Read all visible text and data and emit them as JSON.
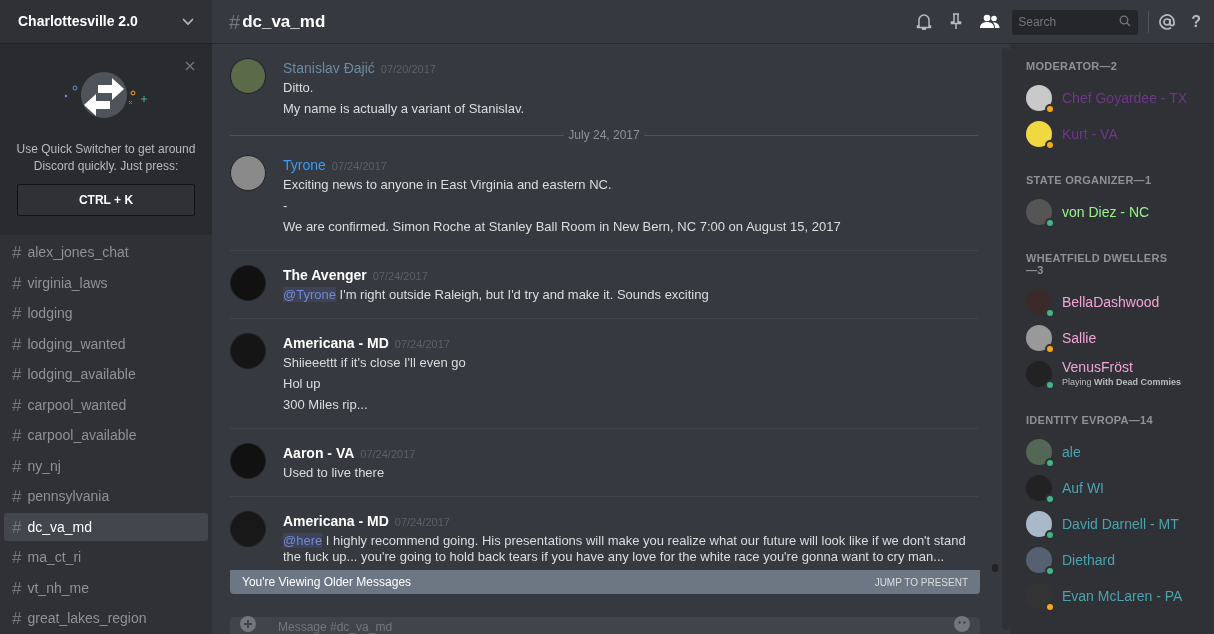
{
  "server": {
    "name": "Charlottesville 2.0"
  },
  "quick_switcher": {
    "text": "Use Quick Switcher to get around Discord quickly. Just press:",
    "shortcut": "CTRL + K"
  },
  "channels": [
    {
      "name": "alex_jones_chat",
      "selected": false
    },
    {
      "name": "virginia_laws",
      "selected": false
    },
    {
      "name": "lodging",
      "selected": false
    },
    {
      "name": "lodging_wanted",
      "selected": false
    },
    {
      "name": "lodging_available",
      "selected": false
    },
    {
      "name": "carpool_wanted",
      "selected": false
    },
    {
      "name": "carpool_available",
      "selected": false
    },
    {
      "name": "ny_nj",
      "selected": false
    },
    {
      "name": "pennsylvania",
      "selected": false
    },
    {
      "name": "dc_va_md",
      "selected": true
    },
    {
      "name": "ma_ct_ri",
      "selected": false
    },
    {
      "name": "vt_nh_me",
      "selected": false
    },
    {
      "name": "great_lakes_region",
      "selected": false
    }
  ],
  "header": {
    "hash": "#",
    "channel": "dc_va_md",
    "search_placeholder": "Search",
    "help": "?"
  },
  "messages": [
    {
      "kind": "message",
      "author": "Stanislav Đajić",
      "color": "#6d8aa3",
      "time": "07/20/2017",
      "lines": [
        {
          "text": "Ditto."
        },
        {
          "text": "My name is actually a variant of Stanislav."
        }
      ]
    },
    {
      "kind": "divider",
      "text": "July 24, 2017"
    },
    {
      "kind": "message",
      "author": "Tyrone",
      "color": "#3d9cf0",
      "time": "07/24/2017",
      "lines": [
        {
          "text": "Exciting news to anyone in East Virginia and eastern NC."
        },
        {
          "text": "-"
        },
        {
          "text": "We are confirmed. Simon Roche at Stanley Ball Room in New Bern, NC 7:00 on August 15, 2017"
        }
      ]
    },
    {
      "kind": "message",
      "author": "The Avenger",
      "color": "#ffffff",
      "time": "07/24/2017",
      "lines": [
        {
          "mention": "@Tyrone",
          "text": " I'm right outside Raleigh, but I'd try and make it. Sounds exciting"
        }
      ]
    },
    {
      "kind": "message",
      "author": "Americana - MD",
      "color": "#ffffff",
      "time": "07/24/2017",
      "lines": [
        {
          "text": "Shiieeettt if it's close I'll even go"
        },
        {
          "text": "Hol up"
        },
        {
          "text": "300 Miles rip..."
        }
      ]
    },
    {
      "kind": "message",
      "author": "Aaron - VA",
      "color": "#ffffff",
      "time": "07/24/2017",
      "lines": [
        {
          "text": "Used to live there"
        }
      ]
    },
    {
      "kind": "message",
      "author": "Americana - MD",
      "color": "#ffffff",
      "time": "07/24/2017",
      "lines": [
        {
          "mention": "@here",
          "text": " I highly recommend going. His presentations will make you realize what our future will look like if we don't stand the fuck up... you're going to hold back tears if you have any love for the white race you're gonna want to cry man..."
        }
      ]
    }
  ],
  "older_banner": {
    "text": "You're Viewing Older Messages",
    "action": "JUMP TO PRESENT"
  },
  "composer": {
    "placeholder": "Message #dc_va_md"
  },
  "member_groups": [
    {
      "title": "MODERATOR—2",
      "members": [
        {
          "name": "Chef Goyardee - TX",
          "color": "#71368a",
          "idle": true
        },
        {
          "name": "Kurt - VA",
          "color": "#71368a",
          "idle": true
        }
      ]
    },
    {
      "title": "STATE ORGANIZER—1",
      "members": [
        {
          "name": "von Diez - NC",
          "color": "#99f58a",
          "idle": false
        }
      ]
    },
    {
      "title": "WHEATFIELD DWELLERS—3",
      "members": [
        {
          "name": "BellaDashwood",
          "color": "#f1a6d6",
          "idle": false
        },
        {
          "name": "Sallie",
          "color": "#f1a6d6",
          "idle": true
        },
        {
          "name": "VenusFröst",
          "color": "#f1a6d6",
          "idle": false,
          "activity": "Playing **With Dead Commies**"
        }
      ]
    },
    {
      "title": "IDENTITY EVROPA—14",
      "members": [
        {
          "name": "ale",
          "color": "#4aa3ad",
          "idle": false
        },
        {
          "name": "Auf WI",
          "color": "#4aa3ad",
          "idle": false
        },
        {
          "name": "David Darnell - MT",
          "color": "#4aa3ad",
          "idle": false
        },
        {
          "name": "Diethard",
          "color": "#4aa3ad",
          "idle": false
        },
        {
          "name": "Evan McLaren - PA",
          "color": "#4aa3ad",
          "idle": true
        }
      ]
    }
  ]
}
